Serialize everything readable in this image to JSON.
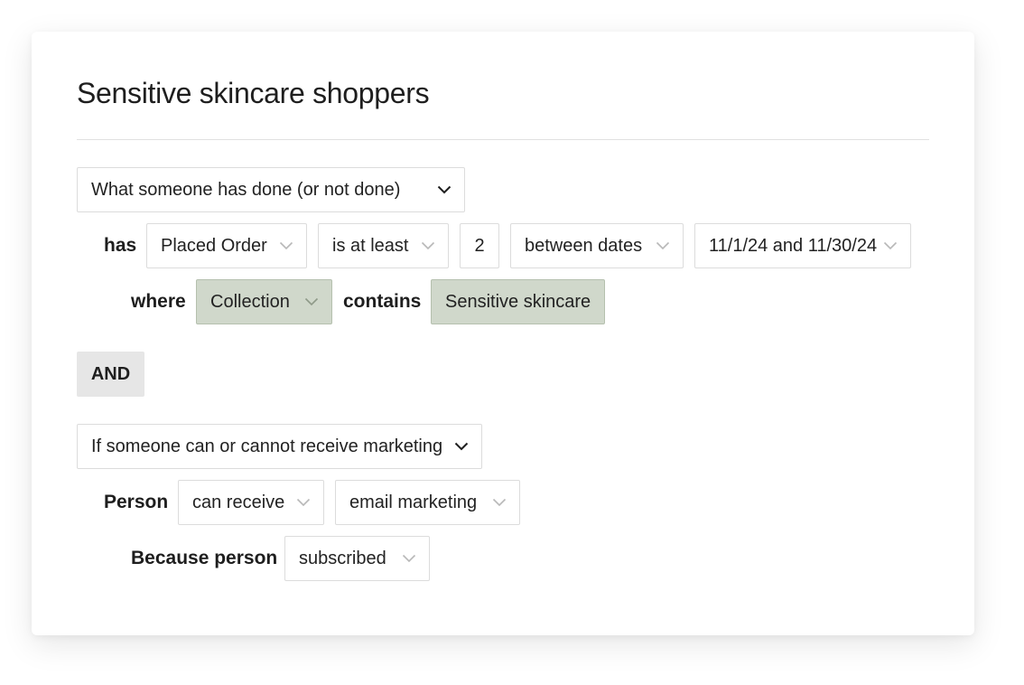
{
  "segment": {
    "title": "Sensitive skincare shoppers"
  },
  "condition1": {
    "type_select": "What someone has done (or not done)",
    "has_label": "has",
    "metric": "Placed Order",
    "operator": "is at least",
    "count": "2",
    "timeframe": "between dates",
    "date_range": "11/1/24 and 11/30/24",
    "where_label": "where",
    "property": "Collection",
    "contains_label": "contains",
    "value": "Sensitive skincare"
  },
  "joiner": {
    "label": "AND"
  },
  "condition2": {
    "type_select": "If someone can or cannot receive marketing",
    "person_label": "Person",
    "ability": "can receive",
    "channel": "email marketing",
    "because_label": "Because person",
    "reason": "subscribed"
  },
  "icons": {
    "dropdown_strong": "chevron-down-icon",
    "dropdown_light": "chevron-down-icon"
  },
  "colors": {
    "highlight_fill": "#d0d8cb",
    "and_button_fill": "#e6e6e6",
    "chevron_light": "#b8b8b8"
  }
}
